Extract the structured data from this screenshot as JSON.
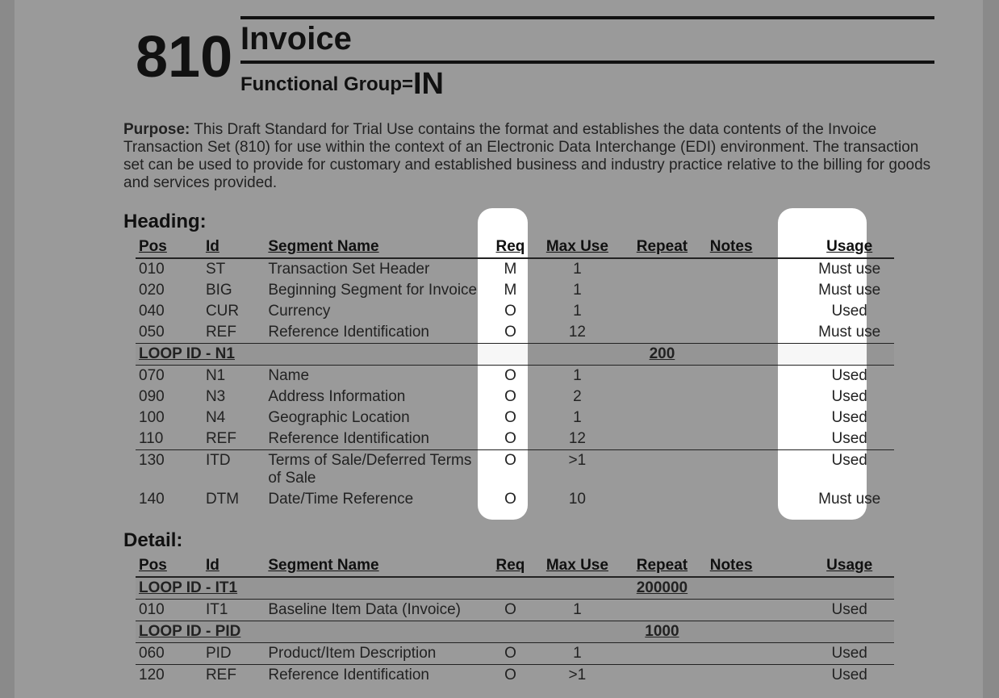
{
  "ts_number": "810",
  "title": "Invoice",
  "fg_label": "Functional Group=",
  "fg_code": "IN",
  "purpose_label": "Purpose:",
  "purpose_text": "This Draft Standard for Trial Use contains the format and establishes the data contents of the Invoice Transaction Set (810) for use within the context of an Electronic Data Interchange (EDI) environment. The transaction set can be used to provide for customary and established business and industry practice relative to the billing for goods and services provided.",
  "cols": {
    "pos": "Pos",
    "id": "Id",
    "name": "Segment Name",
    "req": "Req",
    "max": "Max Use",
    "rep": "Repeat",
    "notes": "Notes",
    "usage": "Usage"
  },
  "sections": {
    "heading": {
      "label": "Heading:",
      "rows": [
        {
          "pos": "010",
          "id": "ST",
          "name": "Transaction Set Header",
          "req": "M",
          "max": "1",
          "rep": "",
          "notes": "",
          "usage": "Must use"
        },
        {
          "pos": "020",
          "id": "BIG",
          "name": "Beginning Segment for Invoice",
          "req": "M",
          "max": "1",
          "rep": "",
          "notes": "",
          "usage": "Must use"
        },
        {
          "pos": "040",
          "id": "CUR",
          "name": "Currency",
          "req": "O",
          "max": "1",
          "rep": "",
          "notes": "",
          "usage": "Used"
        },
        {
          "pos": "050",
          "id": "REF",
          "name": "Reference Identification",
          "req": "O",
          "max": "12",
          "rep": "",
          "notes": "",
          "usage": "Must use"
        },
        {
          "loop": true,
          "name": "LOOP ID - N1",
          "rep": "200"
        },
        {
          "pos": "070",
          "id": "N1",
          "name": "Name",
          "req": "O",
          "max": "1",
          "rep": "",
          "notes": "",
          "usage": "Used"
        },
        {
          "pos": "090",
          "id": "N3",
          "name": "Address Information",
          "req": "O",
          "max": "2",
          "rep": "",
          "notes": "",
          "usage": "Used"
        },
        {
          "pos": "100",
          "id": "N4",
          "name": "Geographic Location",
          "req": "O",
          "max": "1",
          "rep": "",
          "notes": "",
          "usage": "Used"
        },
        {
          "pos": "110",
          "id": "REF",
          "name": "Reference Identification",
          "req": "O",
          "max": "12",
          "rep": "",
          "notes": "",
          "usage": "Used"
        },
        {
          "pos": "130",
          "id": "ITD",
          "name": "Terms of Sale/Deferred Terms of Sale",
          "req": "O",
          "max": ">1",
          "rep": "",
          "notes": "",
          "usage": "Used",
          "after_loop": true
        },
        {
          "pos": "140",
          "id": "DTM",
          "name": "Date/Time Reference",
          "req": "O",
          "max": "10",
          "rep": "",
          "notes": "",
          "usage": "Must use"
        }
      ]
    },
    "detail": {
      "label": "Detail:",
      "rows": [
        {
          "loop": true,
          "name": "LOOP ID - IT1",
          "rep": "200000"
        },
        {
          "pos": "010",
          "id": "IT1",
          "name": "Baseline Item Data (Invoice)",
          "req": "O",
          "max": "1",
          "rep": "",
          "notes": "",
          "usage": "Used"
        },
        {
          "loop": true,
          "name": "LOOP ID - PID",
          "rep": "1000"
        },
        {
          "pos": "060",
          "id": "PID",
          "name": "Product/Item Description",
          "req": "O",
          "max": "1",
          "rep": "",
          "notes": "",
          "usage": "Used"
        },
        {
          "pos": "120",
          "id": "REF",
          "name": "Reference Identification",
          "req": "O",
          "max": ">1",
          "rep": "",
          "notes": "",
          "usage": "Used",
          "after_loop": true
        }
      ]
    }
  }
}
